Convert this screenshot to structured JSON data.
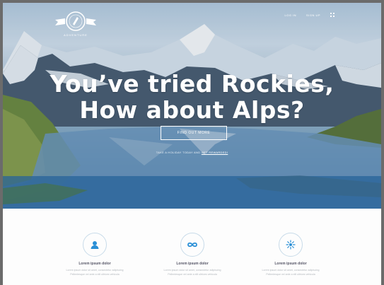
{
  "nav": {
    "login": "LOG IN",
    "signup": "SIGN UP",
    "menu_icon": "grid-icon"
  },
  "logo": {
    "icon": "compass-icon",
    "text": "ADVENTURE"
  },
  "hero": {
    "headline_line1": "You’ve tried Rockies,",
    "headline_line2": "How about Alps?",
    "cta_label": "FIND OUT MORE",
    "subline_text": "TAKE A HOLIDAY TODAY AND",
    "subline_link": "GET REWARDED!"
  },
  "features": [
    {
      "icon": "person-icon",
      "title": "Lorem ipsum dolor",
      "line1": "Lorem ipsum dolor sit amet, consectetur adipiscing",
      "line2": "Pellentesque vel ante a elit ultrices vehicula"
    },
    {
      "icon": "infinity-icon",
      "title": "Lorem ipsum dolor",
      "line1": "Lorem ipsum dolor sit amet, consectetur adipiscing",
      "line2": "Pellentesque vel ante a elit ultrices vehicula"
    },
    {
      "icon": "snowflake-icon",
      "title": "Lorem ipsum dolor",
      "line1": "Lorem ipsum dolor sit amet, consectetur adipiscing",
      "line2": "Pellentesque vel ante a elit ultrices vehicula"
    }
  ],
  "colors": {
    "accent": "#2a8fd6",
    "icon_ring": "#c8dbe9"
  }
}
